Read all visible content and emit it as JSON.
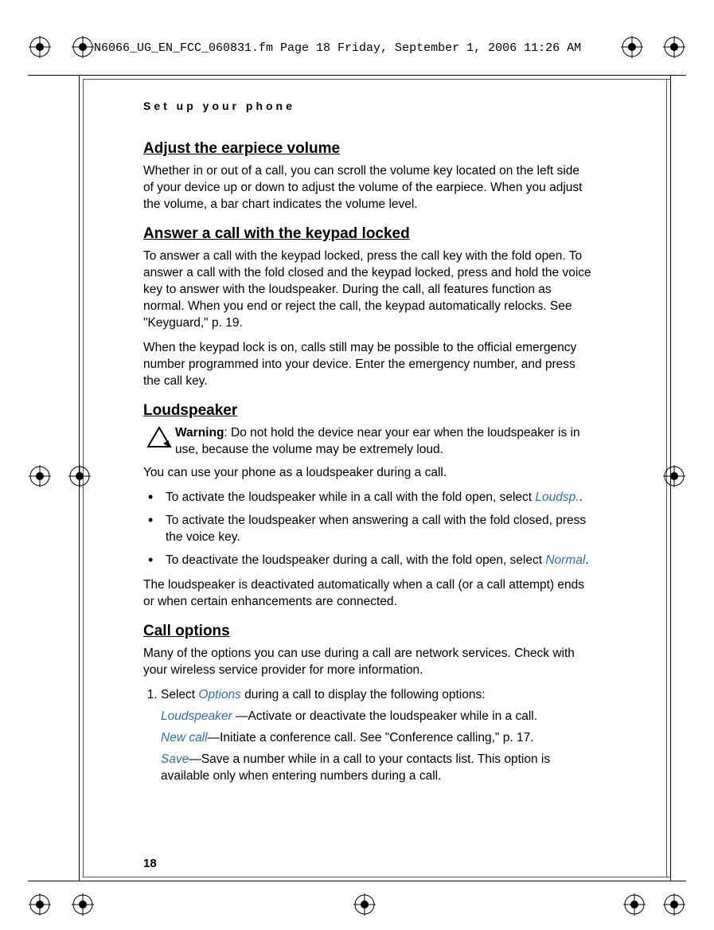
{
  "header_line": "N6066_UG_EN_FCC_060831.fm  Page 18  Friday, September 1, 2006  11:26 AM",
  "running_head": "Set up your phone",
  "page_number": "18",
  "sections": {
    "s1": {
      "title": "Adjust the earpiece volume",
      "p1": "Whether in or out of a call, you can scroll the volume key located on the left side of your device up or down to adjust the volume of the earpiece. When you adjust the volume, a bar chart indicates the volume level."
    },
    "s2": {
      "title": "Answer a call with the keypad locked",
      "p1": "To answer a call with the keypad locked, press the call key with the fold open. To answer a call with the fold closed and the keypad locked, press and hold the voice key to answer with the loudspeaker. During the call, all features function as normal. When you end or reject the call, the keypad automatically relocks. See \"Keyguard,\" p. 19.",
      "p2": "When the keypad lock is on, calls still may be possible to the official emergency number programmed into your device. Enter the emergency number, and press the call key."
    },
    "s3": {
      "title": "Loudspeaker",
      "warn_label": "Warning",
      "warn_text": ": Do not hold the device near your ear when the loudspeaker is in use, because the volume may be extremely loud.",
      "p1": "You can use your phone as a loudspeaker during a call.",
      "b1a": "To activate the loudspeaker while in a call with the fold open, select ",
      "b1_ui": "Loudsp.",
      "b1b": ".",
      "b2": "To activate the loudspeaker when answering a call with the fold closed, press the voice key.",
      "b3a": "To deactivate the loudspeaker during a call, with the fold open, select ",
      "b3_ui": "Normal",
      "b3b": ".",
      "p2": "The loudspeaker is deactivated automatically when a call (or a call attempt) ends or when certain enhancements are connected."
    },
    "s4": {
      "title": "Call options",
      "p1": "Many of the options you can use during a call are network services. Check with your wireless service provider for more information.",
      "step1a": "Select ",
      "step1_ui": "Options",
      "step1b": " during a call to display the following options:",
      "d1_ui": "Loudspeaker ",
      "d1": "—Activate or deactivate the loudspeaker while in a call.",
      "d2_ui": "New call",
      "d2": "—Initiate a conference call. See \"Conference calling,\" p. 17.",
      "d3_ui": "Save",
      "d3": "—Save a number while in a call to your contacts list. This option is available only when entering numbers during a call."
    }
  }
}
